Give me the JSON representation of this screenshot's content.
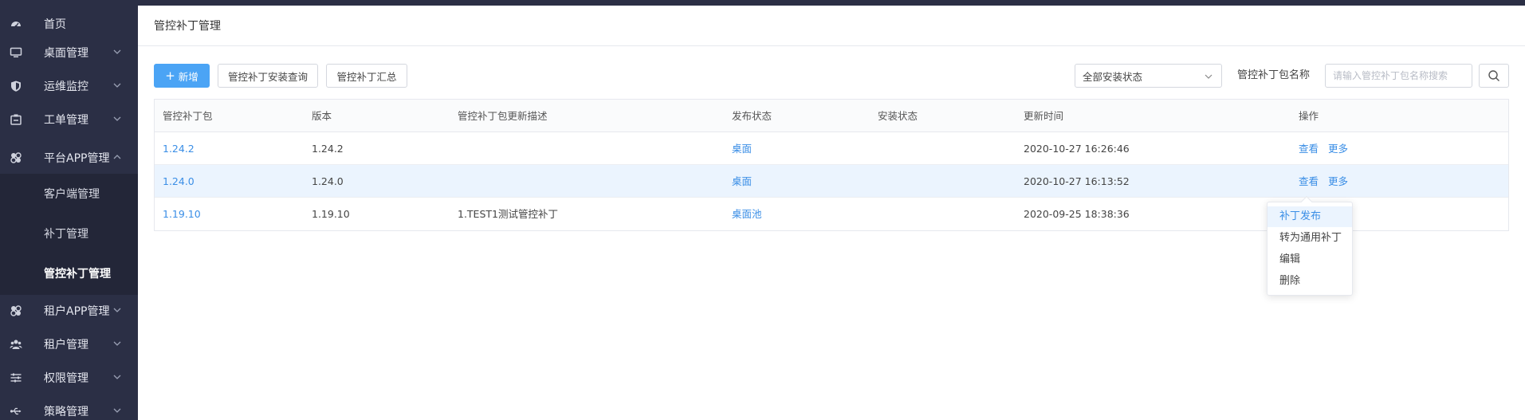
{
  "sidebar": {
    "items": [
      {
        "label": "首页",
        "icon": "dashboard-icon"
      },
      {
        "label": "桌面管理",
        "icon": "monitor-icon"
      },
      {
        "label": "运维监控",
        "icon": "shield-icon"
      },
      {
        "label": "工单管理",
        "icon": "ticket-icon"
      },
      {
        "label": "平台APP管理",
        "icon": "apps-icon"
      },
      {
        "label": "租户APP管理",
        "icon": "apps-icon"
      },
      {
        "label": "租户管理",
        "icon": "users-icon"
      },
      {
        "label": "权限管理",
        "icon": "sliders-icon"
      },
      {
        "label": "策略管理",
        "icon": "usb-icon"
      }
    ],
    "submenu": [
      {
        "label": "客户端管理"
      },
      {
        "label": "补丁管理"
      },
      {
        "label": "管控补丁管理"
      }
    ]
  },
  "header": {
    "title": "管控补丁管理"
  },
  "toolbar": {
    "add_label": "新增",
    "install_query_label": "管控补丁安装查询",
    "summary_label": "管控补丁汇总",
    "status_select": "全部安装状态",
    "name_label": "管控补丁包名称",
    "search_placeholder": "请输入管控补丁包名称搜索"
  },
  "table": {
    "columns": [
      "管控补丁包",
      "版本",
      "管控补丁包更新描述",
      "发布状态",
      "安装状态",
      "更新时间",
      "操作"
    ],
    "rows": [
      {
        "package": "1.24.2",
        "version": "1.24.2",
        "desc": "",
        "publish": "桌面",
        "install": "",
        "updated": "2020-10-27 16:26:46",
        "view": "查看",
        "more": "更多"
      },
      {
        "package": "1.24.0",
        "version": "1.24.0",
        "desc": "",
        "publish": "桌面",
        "install": "",
        "updated": "2020-10-27 16:13:52",
        "view": "查看",
        "more": "更多"
      },
      {
        "package": "1.19.10",
        "version": "1.19.10",
        "desc": "1.TEST1测试管控补丁",
        "publish": "桌面池",
        "install": "",
        "updated": "2020-09-25 18:38:36",
        "view": "",
        "more": ""
      }
    ]
  },
  "dropdown": {
    "items": [
      "补丁发布",
      "转为通用补丁",
      "编辑",
      "删除"
    ]
  },
  "colors": {
    "sidebar_bg": "#2b2f45",
    "submenu_bg": "#232638",
    "accent": "#4ba4f5",
    "link": "#3a8ee6",
    "row_hover": "#ebf4fe"
  }
}
